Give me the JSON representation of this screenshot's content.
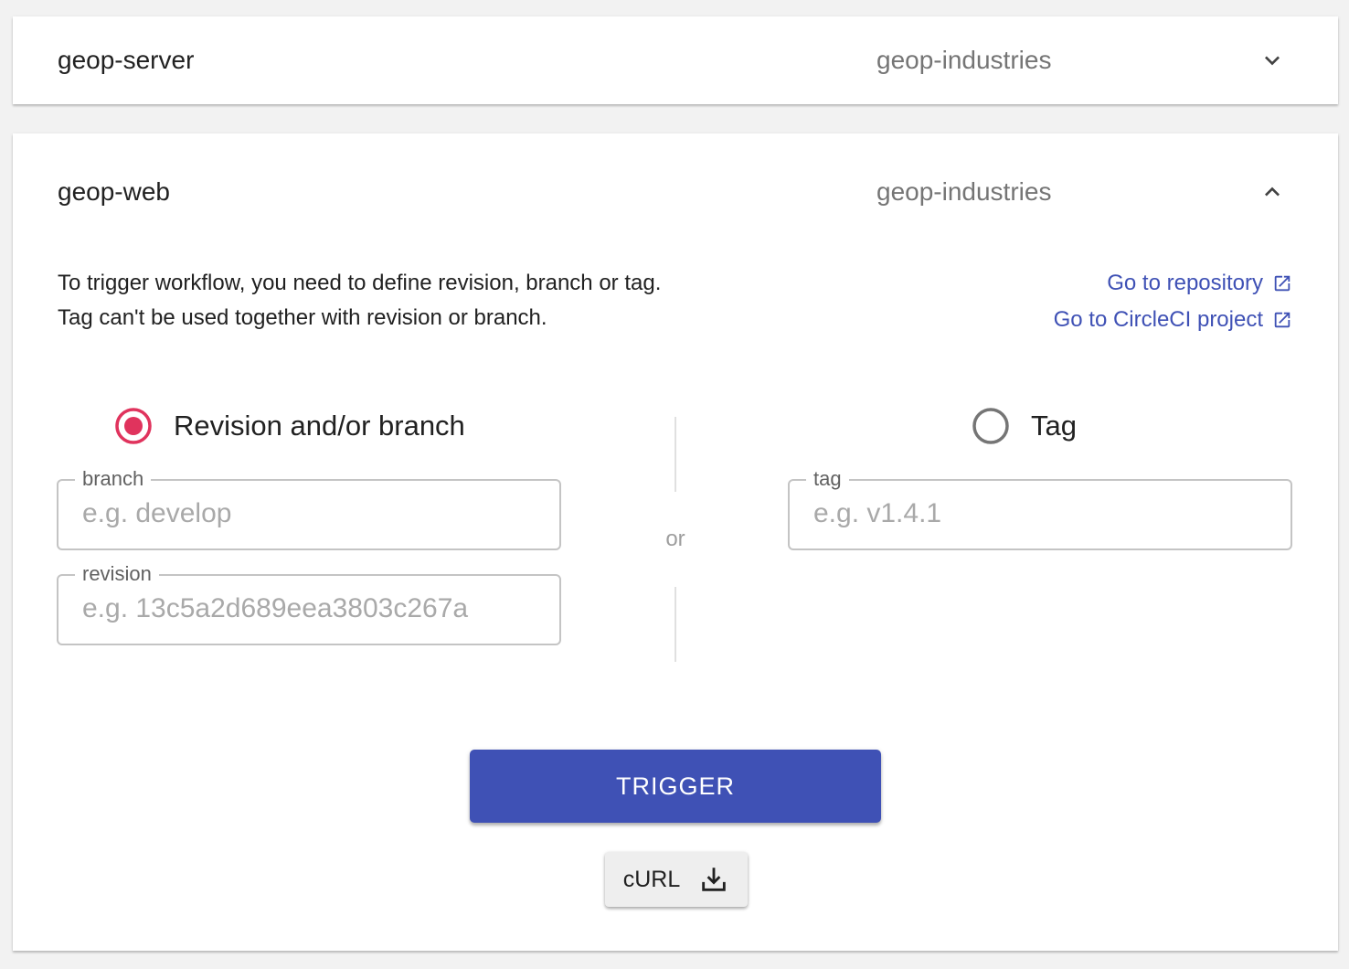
{
  "projects": [
    {
      "name": "geop-server",
      "org": "geop-industries",
      "expand_icon": "chevron-down-icon"
    },
    {
      "name": "geop-web",
      "org": "geop-industries",
      "expand_icon": "chevron-up-icon",
      "description_line1": "To trigger workflow, you need to define revision, branch or tag.",
      "description_line2": "Tag can't be used together with revision or branch.",
      "links": {
        "repository": "Go to repository",
        "circleci": "Go to CircleCI project",
        "icon": "open-in-new-icon"
      },
      "options": {
        "revision_branch": {
          "label": "Revision and/or branch",
          "selected": true
        },
        "tag": {
          "label": "Tag",
          "selected": false
        }
      },
      "fields": {
        "branch": {
          "label": "branch",
          "placeholder": "e.g. develop",
          "value": ""
        },
        "revision": {
          "label": "revision",
          "placeholder": "e.g. 13c5a2d689eea3803c267a",
          "value": ""
        },
        "tag": {
          "label": "tag",
          "placeholder": "e.g. v1.4.1",
          "value": ""
        }
      },
      "separator": "or",
      "trigger_label": "TRIGGER",
      "curl_label": "cURL",
      "curl_icon": "download-icon"
    }
  ],
  "colors": {
    "accent": "#3f51b5",
    "radio_selected": "#e0335d",
    "radio_unselected": "#757575",
    "background": "#f2f2f2"
  }
}
